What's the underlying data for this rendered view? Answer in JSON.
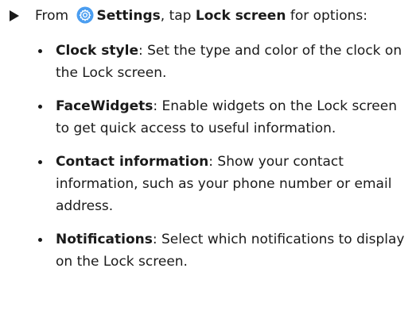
{
  "intro": {
    "from": "From",
    "settings": "Settings",
    "tap": ", tap",
    "lock_screen": "Lock screen",
    "rest": "for options:"
  },
  "icons": {
    "bullet_arrow": "right-triangle-icon",
    "settings": "settings-gear-icon",
    "accent": "#4a9df0"
  },
  "items": [
    {
      "term": "Clock style",
      "text": ": Set the type and color of the clock on the Lock screen."
    },
    {
      "term": "FaceWidgets",
      "text": ": Enable widgets on the Lock screen to get quick access to useful information."
    },
    {
      "term": "Contact information",
      "text": ": Show your contact information, such as your phone number or email address."
    },
    {
      "term": "Notifications",
      "text": ": Select which notifications to display on the Lock screen."
    }
  ]
}
